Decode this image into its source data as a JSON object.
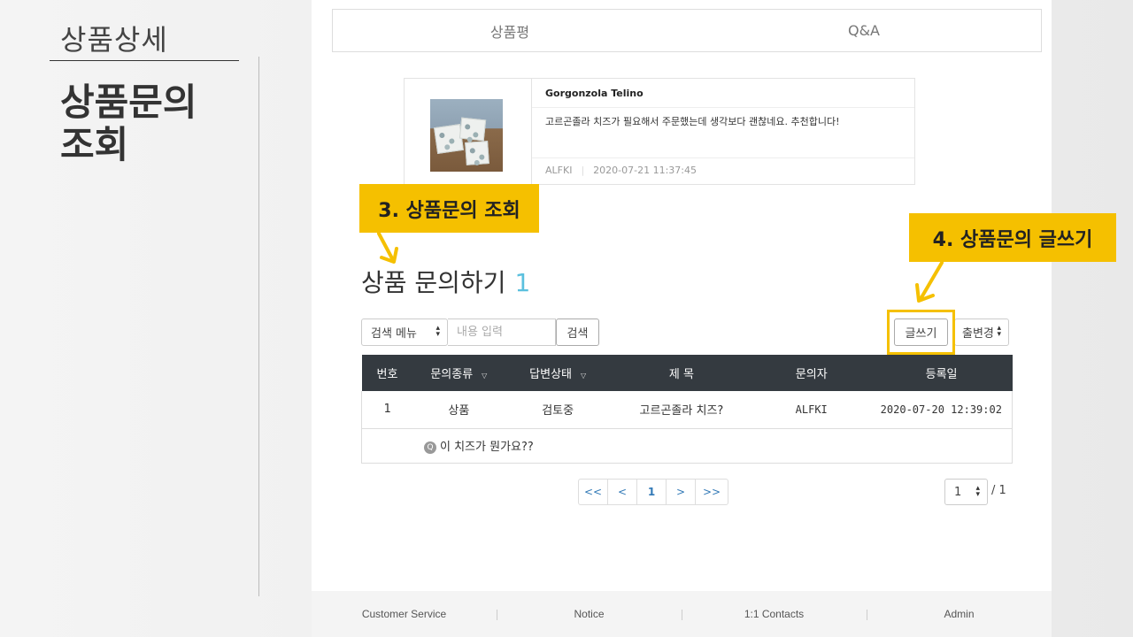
{
  "slide": {
    "subtitle": "상품상세",
    "title": "상품문의\n조회"
  },
  "tabs": [
    {
      "label": "상품평"
    },
    {
      "label": "Q&A"
    }
  ],
  "review": {
    "product_name": "Gorgonzola Telino",
    "content": "고르곤졸라 치즈가 필요해서 주문했는데 생각보다 괜찮네요. 추천합니다!",
    "author": "ALFKI",
    "date": "2020-07-21 11:37:45"
  },
  "callouts": {
    "view": "3. 상품문의 조회",
    "write": "4. 상품문의 글쓰기"
  },
  "qa": {
    "title": "상품 문의하기",
    "count": "1",
    "search_menu": "검색 메뉴",
    "search_placeholder": "내용 입력",
    "search_button": "검색",
    "write_button": "글쓰기",
    "sort_select": "출변경",
    "columns": [
      "번호",
      "문의종류",
      "답변상태",
      "제 목",
      "문의자",
      "등록일"
    ],
    "rows": [
      {
        "no": "1",
        "type": "상품",
        "status": "검토중",
        "subject": "고르곤졸라 치즈?",
        "author": "ALFKI",
        "date": "2020-07-20 12:39:02",
        "question": "이 치즈가 뭔가요??"
      }
    ]
  },
  "pagination": {
    "first": "<<",
    "prev": "<",
    "current": "1",
    "next": ">",
    "last": ">>",
    "page_select": "1",
    "total": "/ 1"
  },
  "footer": [
    "Customer Service",
    "Notice",
    "1:1 Contacts",
    "Admin"
  ],
  "colors": {
    "callout": "#f5c000",
    "table_header": "#343a40",
    "count_accent": "#5bc0de",
    "link": "#337ab7"
  }
}
